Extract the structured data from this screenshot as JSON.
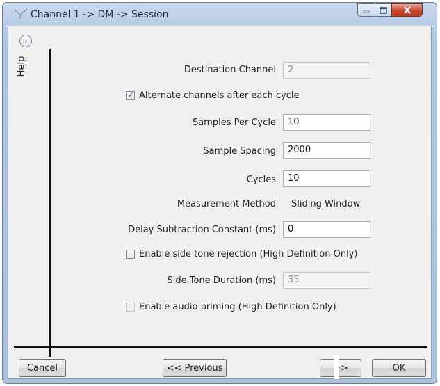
{
  "window": {
    "title": "Channel 1 -> DM -> Session",
    "controls": {
      "minimize": "minimize",
      "maximize": "maximize",
      "close": "close"
    }
  },
  "help": {
    "toggle_icon": "›",
    "label": "Help"
  },
  "form": {
    "destination_channel": {
      "label": "Destination Channel",
      "value": "2",
      "enabled": false
    },
    "alternate_channels": {
      "label": "Alternate channels after each cycle",
      "checked": true
    },
    "samples_per_cycle": {
      "label": "Samples Per Cycle",
      "value": "10"
    },
    "sample_spacing": {
      "label": "Sample Spacing",
      "value": "2000"
    },
    "cycles": {
      "label": "Cycles",
      "value": "10"
    },
    "measurement_method": {
      "label": "Measurement Method",
      "value": "Sliding Window"
    },
    "delay_subtraction": {
      "label": "Delay Subtraction Constant (ms)",
      "value": "0"
    },
    "side_tone_rejection": {
      "label": "Enable side tone rejection (High Definition Only)",
      "checked": false
    },
    "side_tone_duration": {
      "label": "Side Tone Duration (ms)",
      "value": "35",
      "enabled": false
    },
    "audio_priming": {
      "label": "Enable audio priming (High Definition Only)",
      "checked": false
    }
  },
  "footer": {
    "cancel": "Cancel",
    "previous": "<< Previous",
    "next": ">>",
    "ok": "OK"
  }
}
